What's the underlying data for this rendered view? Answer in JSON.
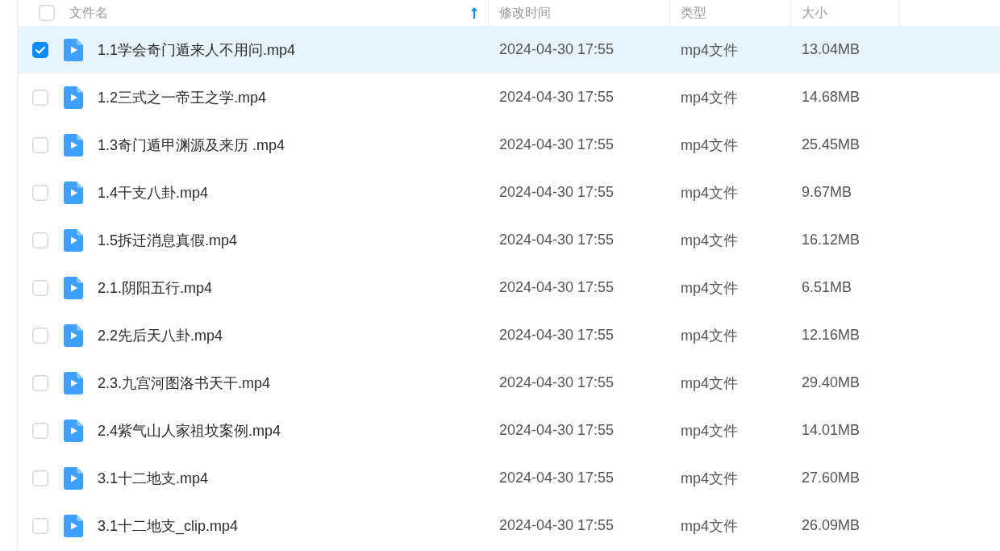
{
  "table": {
    "select_all": {
      "checked": false
    },
    "columns": [
      {
        "label": "文件名",
        "sorted": true
      },
      {
        "label": "修改时间",
        "sorted": false
      },
      {
        "label": "类型",
        "sorted": false
      },
      {
        "label": "大小",
        "sorted": false
      }
    ],
    "rows": [
      {
        "name": "1.1学会奇门遁来人不用问.mp4",
        "modified": "2024-04-30 17:55",
        "type": "mp4文件",
        "size": "13.04MB",
        "selected": true
      },
      {
        "name": "1.2三式之一帝王之学.mp4",
        "modified": "2024-04-30 17:55",
        "type": "mp4文件",
        "size": "14.68MB",
        "selected": false
      },
      {
        "name": "1.3奇门遁甲渊源及来历 .mp4",
        "modified": "2024-04-30 17:55",
        "type": "mp4文件",
        "size": "25.45MB",
        "selected": false
      },
      {
        "name": "1.4干支八卦.mp4",
        "modified": "2024-04-30 17:55",
        "type": "mp4文件",
        "size": "9.67MB",
        "selected": false
      },
      {
        "name": "1.5拆迁消息真假.mp4",
        "modified": "2024-04-30 17:55",
        "type": "mp4文件",
        "size": "16.12MB",
        "selected": false
      },
      {
        "name": "2.1.阴阳五行.mp4",
        "modified": "2024-04-30 17:55",
        "type": "mp4文件",
        "size": "6.51MB",
        "selected": false
      },
      {
        "name": "2.2先后天八卦.mp4",
        "modified": "2024-04-30 17:55",
        "type": "mp4文件",
        "size": "12.16MB",
        "selected": false
      },
      {
        "name": "2.3.九宫河图洛书天干.mp4",
        "modified": "2024-04-30 17:55",
        "type": "mp4文件",
        "size": "29.40MB",
        "selected": false
      },
      {
        "name": "2.4紫气山人家祖坟案例.mp4",
        "modified": "2024-04-30 17:55",
        "type": "mp4文件",
        "size": "14.01MB",
        "selected": false
      },
      {
        "name": "3.1十二地支.mp4",
        "modified": "2024-04-30 17:55",
        "type": "mp4文件",
        "size": "27.60MB",
        "selected": false
      },
      {
        "name": "3.1十二地支_clip.mp4",
        "modified": "2024-04-30 17:55",
        "type": "mp4文件",
        "size": "26.09MB",
        "selected": false
      }
    ]
  }
}
